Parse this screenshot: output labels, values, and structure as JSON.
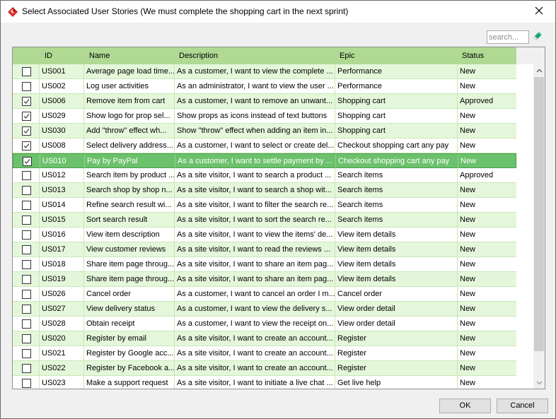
{
  "window": {
    "title": "Select Associated User Stories (We must complete the shopping cart in the next sprint)",
    "app_icon": "visual-paradigm-diamond-icon",
    "close_icon": "close-icon"
  },
  "search": {
    "placeholder": "search...",
    "value": "",
    "clear_icon": "eraser-icon"
  },
  "table": {
    "columns": [
      "",
      "ID",
      "Name",
      "Description",
      "Epic",
      "Status"
    ],
    "rows": [
      {
        "checked": false,
        "id": "US001",
        "name": "Average page load time...",
        "description": "As a customer, I want to view the complete ...",
        "epic": "Performance",
        "status": "New"
      },
      {
        "checked": false,
        "id": "US002",
        "name": "Log user activities",
        "description": "As an administrator, I want to view the user ...",
        "epic": "Performance",
        "status": "New"
      },
      {
        "checked": true,
        "id": "US006",
        "name": "Remove item from cart",
        "description": "As a customer, I want to remove an unwant...",
        "epic": "Shopping cart",
        "status": "Approved"
      },
      {
        "checked": true,
        "id": "US029",
        "name": "Show logo for prop sel...",
        "description": "Show props as icons instead of text buttons",
        "epic": "Shopping cart",
        "status": "New"
      },
      {
        "checked": true,
        "id": "US030",
        "name": "Add \"throw\" effect wh...",
        "description": "Show \"throw\" effect when adding an item in...",
        "epic": "Shopping cart",
        "status": "New"
      },
      {
        "checked": true,
        "id": "US008",
        "name": "Select delivery address...",
        "description": "As a customer, I want to select or create del...",
        "epic": "Checkout shopping cart any pay",
        "status": "New"
      },
      {
        "checked": true,
        "id": "US010",
        "name": "Pay by PayPal",
        "description": "As a customer, I want to settle payment by ...",
        "epic": "Checkout shopping cart any pay",
        "status": "New",
        "selected": true
      },
      {
        "checked": false,
        "id": "US012",
        "name": "Search item by product ...",
        "description": "As a site visitor, I want to search a product ...",
        "epic": "Search items",
        "status": "Approved"
      },
      {
        "checked": false,
        "id": "US013",
        "name": "Search shop by shop n...",
        "description": "As a site visitor, I want to search a shop wit...",
        "epic": "Search items",
        "status": "New"
      },
      {
        "checked": false,
        "id": "US014",
        "name": "Refine search result wi...",
        "description": "As a site visitor, I want to filter the search re...",
        "epic": "Search items",
        "status": "New"
      },
      {
        "checked": false,
        "id": "US015",
        "name": "Sort search result",
        "description": "As a site visitor, I want to sort the search re...",
        "epic": "Search items",
        "status": "New"
      },
      {
        "checked": false,
        "id": "US016",
        "name": "View item description",
        "description": "As a site visitor, I want to view the items' de...",
        "epic": "View item details",
        "status": "New"
      },
      {
        "checked": false,
        "id": "US017",
        "name": "View customer reviews",
        "description": "As a site visitor, I want to read the reviews ...",
        "epic": "View item details",
        "status": "New"
      },
      {
        "checked": false,
        "id": "US018",
        "name": "Share item page throug...",
        "description": "As a site visitor, I want to share an item pag...",
        "epic": "View item details",
        "status": "New"
      },
      {
        "checked": false,
        "id": "US019",
        "name": "Share item page throug...",
        "description": "As a site visitor, I want to share an item pag...",
        "epic": "View item details",
        "status": "New"
      },
      {
        "checked": false,
        "id": "US026",
        "name": "Cancel order",
        "description": "As a customer, I want to cancel an order I m...",
        "epic": "Cancel order",
        "status": "New"
      },
      {
        "checked": false,
        "id": "US027",
        "name": "View delivery status",
        "description": "As a customer, I want to view the delivery s...",
        "epic": "View order detail",
        "status": "New"
      },
      {
        "checked": false,
        "id": "US028",
        "name": "Obtain receipt",
        "description": "As a customer, I want to view the receipt on...",
        "epic": "View order detail",
        "status": "New"
      },
      {
        "checked": false,
        "id": "US020",
        "name": "Register by email",
        "description": "As a site visitor, I want to create an account...",
        "epic": "Register",
        "status": "New"
      },
      {
        "checked": false,
        "id": "US021",
        "name": "Register by Google acc...",
        "description": "As a site visitor, I want to create an account...",
        "epic": "Register",
        "status": "New"
      },
      {
        "checked": false,
        "id": "US022",
        "name": "Register by Facebook a...",
        "description": "As a site visitor, I want to create an account...",
        "epic": "Register",
        "status": "New"
      },
      {
        "checked": false,
        "id": "US023",
        "name": "Make a support request",
        "description": "As a site visitor, I want to initiate a live chat ...",
        "epic": "Get live help",
        "status": "New"
      }
    ]
  },
  "buttons": {
    "ok": "OK",
    "cancel": "Cancel"
  },
  "colors": {
    "header_bg": "#b0d994",
    "row_alt_bg": "#e5f7db",
    "selected_bg": "#6cc16c",
    "accent_red": "#d9312d"
  }
}
